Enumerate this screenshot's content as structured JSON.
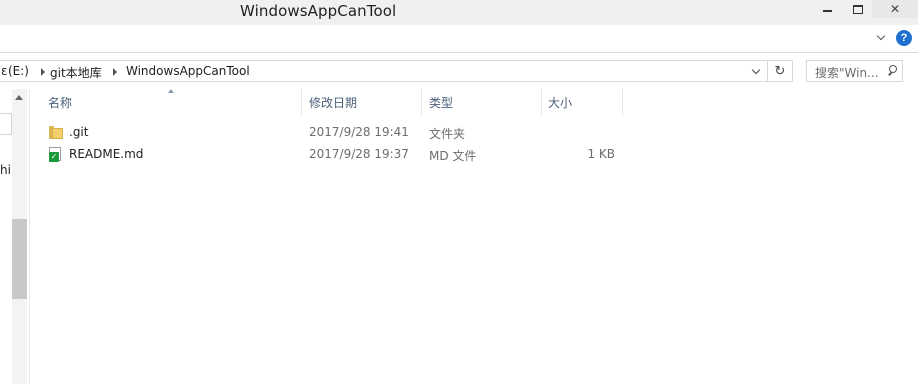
{
  "window": {
    "title": "WindowsAppCanTool",
    "controls": {
      "minimize_icon": "minimize-icon",
      "maximize_icon": "maximize-icon",
      "close_icon": "close-icon",
      "close_glyph": "✕"
    }
  },
  "ribbon": {
    "help_glyph": "?"
  },
  "address": {
    "breadcrumbs": [
      {
        "label": "(E:)"
      },
      {
        "label": "git本地库"
      },
      {
        "label": "WindowsAppCanTool"
      }
    ],
    "drive_prefix": "ε",
    "refresh_glyph": "↻"
  },
  "search": {
    "placeholder": "搜索\"Win..."
  },
  "navpane": {
    "snippet": "hi"
  },
  "columns": {
    "name": "名称",
    "date_modified": "修改日期",
    "type": "类型",
    "size": "大小"
  },
  "files": [
    {
      "name": ".git",
      "date": "2017/9/28 19:41",
      "type": "文件夹",
      "size": "",
      "icon": "folder-icon"
    },
    {
      "name": "README.md",
      "date": "2017/9/28 19:37",
      "type": "MD 文件",
      "size": "1 KB",
      "icon": "md-file-icon"
    }
  ],
  "colors": {
    "header_text": "#4c607a",
    "help_blue": "#1e6fd0",
    "folder": "#f1cf6b"
  }
}
